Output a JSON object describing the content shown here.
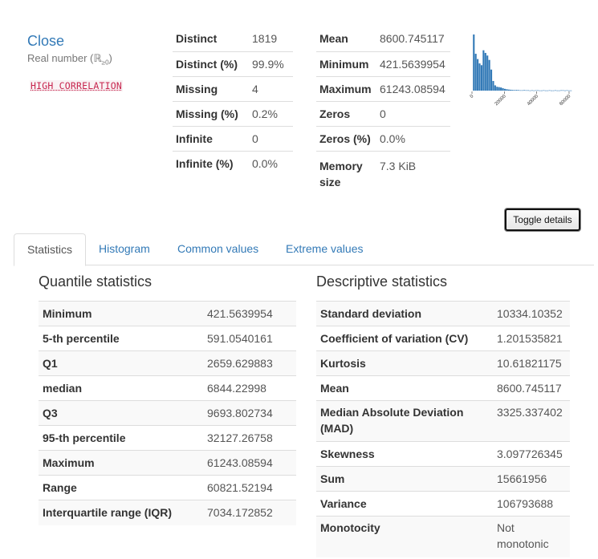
{
  "variable": {
    "name": "Close",
    "type_prefix": "Real number (ℝ",
    "type_sub": "≥0",
    "type_suffix": ")",
    "alert": "HIGH CORRELATION"
  },
  "overview_left": [
    {
      "label": "Distinct",
      "value": "1819"
    },
    {
      "label": "Distinct (%)",
      "value": "99.9%"
    },
    {
      "label": "Missing",
      "value": "4"
    },
    {
      "label": "Missing (%)",
      "value": "0.2%"
    },
    {
      "label": "Infinite",
      "value": "0"
    },
    {
      "label": "Infinite (%)",
      "value": "0.0%"
    }
  ],
  "overview_right": [
    {
      "label": "Mean",
      "value": "8600.745117"
    },
    {
      "label": "Minimum",
      "value": "421.5639954"
    },
    {
      "label": "Maximum",
      "value": "61243.08594"
    },
    {
      "label": "Zeros",
      "value": "0"
    },
    {
      "label": "Zeros (%)",
      "value": "0.0%"
    },
    {
      "label": "Memory size",
      "value": "7.3 KiB"
    }
  ],
  "toggle_button": "Toggle details",
  "tabs": [
    {
      "label": "Statistics",
      "active": true
    },
    {
      "label": "Histogram",
      "active": false
    },
    {
      "label": "Common values",
      "active": false
    },
    {
      "label": "Extreme values",
      "active": false
    }
  ],
  "quantile": {
    "title": "Quantile statistics",
    "rows": [
      {
        "label": "Minimum",
        "value": "421.5639954"
      },
      {
        "label": "5-th percentile",
        "value": "591.0540161"
      },
      {
        "label": "Q1",
        "value": "2659.629883"
      },
      {
        "label": "median",
        "value": "6844.22998"
      },
      {
        "label": "Q3",
        "value": "9693.802734"
      },
      {
        "label": "95-th percentile",
        "value": "32127.26758"
      },
      {
        "label": "Maximum",
        "value": "61243.08594"
      },
      {
        "label": "Range",
        "value": "60821.52194"
      },
      {
        "label": "Interquartile range (IQR)",
        "value": "7034.172852"
      }
    ]
  },
  "descriptive": {
    "title": "Descriptive statistics",
    "rows": [
      {
        "label": "Standard deviation",
        "value": "10334.10352"
      },
      {
        "label": "Coefficient of variation (CV)",
        "value": "1.201535821"
      },
      {
        "label": "Kurtosis",
        "value": "10.61821175"
      },
      {
        "label": "Mean",
        "value": "8600.745117"
      },
      {
        "label": "Median Absolute Deviation (MAD)",
        "value": "3325.337402"
      },
      {
        "label": "Skewness",
        "value": "3.097726345"
      },
      {
        "label": "Sum",
        "value": "15661956"
      },
      {
        "label": "Variance",
        "value": "106793688"
      },
      {
        "label": "Monotocity",
        "value": "Not monotonic"
      }
    ]
  },
  "chart_data": {
    "type": "bar",
    "title": "",
    "xlabel": "",
    "ylabel": "",
    "xlim": [
      0,
      62000
    ],
    "x_ticks": [
      "0",
      "20000",
      "40000",
      "60000"
    ],
    "bar_color": "#337ab7",
    "bin_centers": [
      1200,
      2400,
      3600,
      4800,
      6000,
      7200,
      8400,
      9600,
      10800,
      12000,
      13200,
      14400,
      15600,
      16800,
      18000,
      19200,
      20400,
      21600,
      22800,
      24000,
      25200,
      26400,
      27600,
      28800,
      30000,
      31200,
      32400,
      33600,
      34800,
      36000,
      37200,
      38400,
      39600,
      40800,
      42000,
      43200,
      44400,
      45600,
      46800,
      48000,
      49200,
      50400,
      51600,
      52800,
      54000,
      55200,
      56400,
      57600,
      58800,
      60000,
      61200
    ],
    "values": [
      320,
      210,
      180,
      155,
      145,
      230,
      215,
      200,
      175,
      120,
      55,
      30,
      22,
      20,
      18,
      14,
      10,
      8,
      6,
      5,
      4,
      3,
      4,
      3,
      2,
      2,
      3,
      2,
      2,
      1,
      2,
      1,
      2,
      2,
      1,
      1,
      2,
      1,
      1,
      2,
      1,
      1,
      2,
      1,
      1,
      2,
      2,
      1,
      2,
      1,
      1
    ]
  }
}
